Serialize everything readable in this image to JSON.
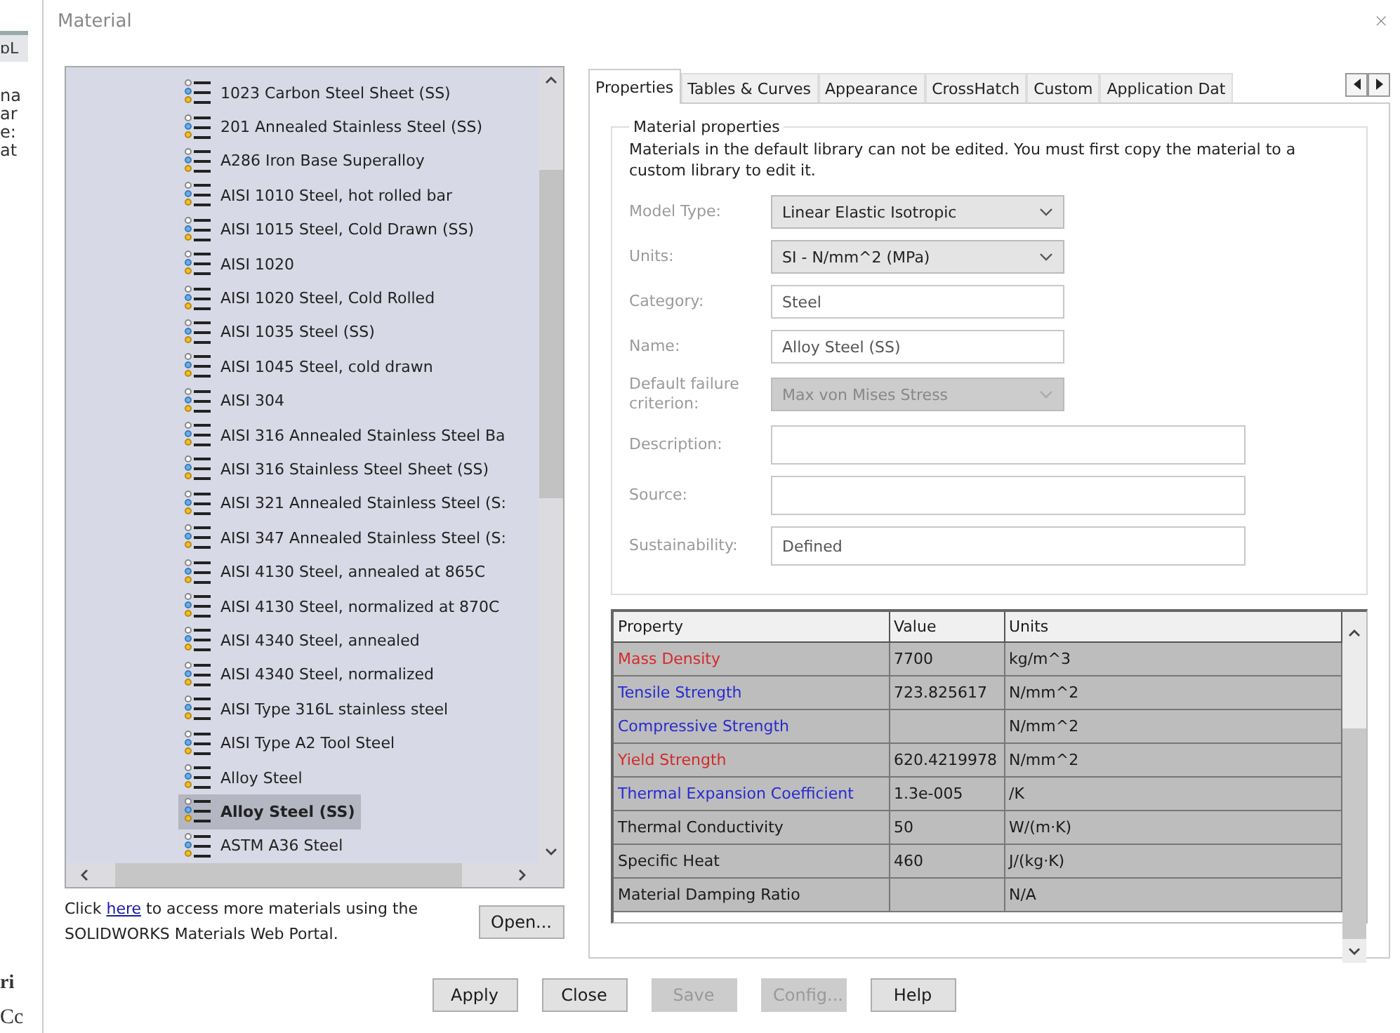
{
  "background_fragments": [
    {
      "text": "ɒL",
      "kind": "tab"
    },
    {
      "text": "na",
      "kind": "line"
    },
    {
      "text": "ar",
      "kind": "line"
    },
    {
      "text": "e:",
      "kind": "line"
    },
    {
      "text": "at",
      "kind": "line"
    },
    {
      "text": "ri",
      "kind": "bold"
    },
    {
      "text": "Cc",
      "kind": "serif"
    }
  ],
  "window": {
    "title": "Material",
    "close": "×"
  },
  "materials": [
    {
      "label": "1023 Carbon Steel Sheet (SS)",
      "selected": false
    },
    {
      "label": "201 Annealed Stainless Steel (SS)",
      "selected": false
    },
    {
      "label": "A286 Iron Base Superalloy",
      "selected": false
    },
    {
      "label": "AISI 1010 Steel, hot rolled bar",
      "selected": false
    },
    {
      "label": "AISI 1015 Steel, Cold Drawn (SS)",
      "selected": false
    },
    {
      "label": "AISI 1020",
      "selected": false
    },
    {
      "label": "AISI 1020 Steel, Cold Rolled",
      "selected": false
    },
    {
      "label": "AISI 1035 Steel (SS)",
      "selected": false
    },
    {
      "label": "AISI 1045 Steel, cold drawn",
      "selected": false
    },
    {
      "label": "AISI 304",
      "selected": false
    },
    {
      "label": "AISI 316 Annealed Stainless Steel Ba",
      "selected": false
    },
    {
      "label": "AISI 316 Stainless Steel Sheet (SS)",
      "selected": false
    },
    {
      "label": "AISI 321 Annealed Stainless Steel (S:",
      "selected": false
    },
    {
      "label": "AISI 347 Annealed Stainless Steel (S:",
      "selected": false
    },
    {
      "label": "AISI 4130 Steel, annealed at 865C",
      "selected": false
    },
    {
      "label": "AISI 4130 Steel, normalized at 870C",
      "selected": false
    },
    {
      "label": "AISI 4340 Steel, annealed",
      "selected": false
    },
    {
      "label": "AISI 4340 Steel, normalized",
      "selected": false
    },
    {
      "label": "AISI Type 316L stainless steel",
      "selected": false
    },
    {
      "label": "AISI Type A2 Tool Steel",
      "selected": false
    },
    {
      "label": "Alloy Steel",
      "selected": false
    },
    {
      "label": "Alloy Steel (SS)",
      "selected": true
    },
    {
      "label": "ASTM A36 Steel",
      "selected": false
    }
  ],
  "footer": {
    "before": "Click ",
    "link": "here",
    "after": " to access more materials using the SOLIDWORKS Materials Web Portal.",
    "button": "Open..."
  },
  "tabs": [
    {
      "label": "Properties",
      "selected": true
    },
    {
      "label": "Tables & Curves",
      "selected": false
    },
    {
      "label": "Appearance",
      "selected": false
    },
    {
      "label": "CrossHatch",
      "selected": false
    },
    {
      "label": "Custom",
      "selected": false
    },
    {
      "label": "Application Dat",
      "selected": false
    }
  ],
  "group": {
    "title": "Material properties",
    "note": "Materials in the default library can not be edited. You must first copy the material to a custom library to edit it."
  },
  "fields": [
    {
      "label": "Model Type:",
      "value": "Linear Elastic Isotropic",
      "kind": "dropdown",
      "disabled": false
    },
    {
      "label": "Units:",
      "value": "SI - N/mm^2 (MPa)",
      "kind": "dropdown",
      "disabled": false
    },
    {
      "label": "Category:",
      "value": "Steel",
      "kind": "short",
      "disabled": false
    },
    {
      "label": "Name:",
      "value": "Alloy Steel (SS)",
      "kind": "short",
      "disabled": false
    },
    {
      "label": "Default failure criterion:",
      "value": "Max von Mises Stress",
      "kind": "dropdown",
      "disabled": true
    },
    {
      "label": "Description:",
      "kind": "long",
      "disabled": false
    },
    {
      "label": "Source:",
      "kind": "long",
      "disabled": false
    },
    {
      "label": "Sustainability:",
      "value": "Defined",
      "kind": "long",
      "disabled": false
    }
  ],
  "table": {
    "columns": [
      "Property",
      "Value",
      "Units"
    ],
    "rows": [
      {
        "property": "Mass Density",
        "value": "7700",
        "units": "kg/m^3",
        "color": "#d42a2a"
      },
      {
        "property": "Tensile Strength",
        "value": "723.825617",
        "units": "N/mm^2",
        "color": "#2a2ad0"
      },
      {
        "property": "Compressive Strength",
        "units": "N/mm^2",
        "color": "#2a2ad0"
      },
      {
        "property": "Yield Strength",
        "value": "620.4219978",
        "units": "N/mm^2",
        "color": "#d42a2a"
      },
      {
        "property": "Thermal Expansion Coefficient",
        "value": "1.3e-005",
        "units": "/K",
        "color": "#2a2ad0"
      },
      {
        "property": "Thermal Conductivity",
        "value": "50",
        "units": "W/(m·K)",
        "color": "#1a1a1a"
      },
      {
        "property": "Specific Heat",
        "value": "460",
        "units": "J/(kg·K)",
        "color": "#1a1a1a"
      },
      {
        "property": "Material Damping Ratio",
        "units": "N/A",
        "color": "#1a1a1a"
      }
    ]
  },
  "buttons": [
    {
      "label": "Apply",
      "disabled": false
    },
    {
      "label": "Close",
      "disabled": false
    },
    {
      "label": "Save",
      "disabled": true
    },
    {
      "label": "Config...",
      "disabled": true
    },
    {
      "label": "Help",
      "disabled": false
    }
  ]
}
